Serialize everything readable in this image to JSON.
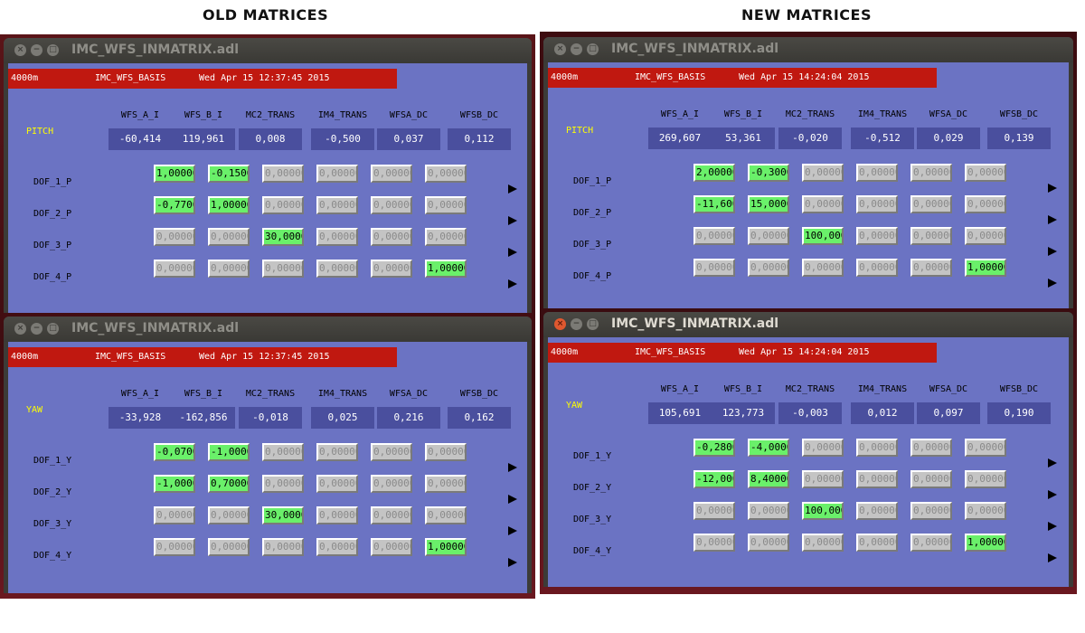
{
  "headings": {
    "old": "OLD MATRICES",
    "new": "NEW MATRICES"
  },
  "window_title": "IMC_WFS_INMATRIX.adl",
  "site": "4000m",
  "basis": "IMC_WFS_BASIS",
  "columns": [
    "WFS_A_I",
    "WFS_B_I",
    "MC2_TRANS",
    "IM4_TRANS",
    "WFSA_DC",
    "WFSB_DC"
  ],
  "colors": {
    "red_bar": "#c01810",
    "panel": "#6b73c3",
    "active_cell": "#6af06a",
    "label": "#ffff00"
  },
  "panels": [
    {
      "side": "old",
      "axis": "PITCH",
      "timestamp": "Wed Apr 15 12:37:45 2015",
      "readouts": [
        "-60,414",
        "119,961",
        "0,008",
        "-0,500",
        "0,037",
        "0,112"
      ],
      "rows": [
        {
          "label": "DOF_1_P",
          "values": [
            "1,00000",
            "-0,1500",
            "0,00000",
            "0,00000",
            "0,00000",
            "0,00000"
          ],
          "active": [
            true,
            true,
            false,
            false,
            false,
            false
          ]
        },
        {
          "label": "DOF_2_P",
          "values": [
            "-0,7700",
            "1,00000",
            "0,00000",
            "0,00000",
            "0,00000",
            "0,00000"
          ],
          "active": [
            true,
            true,
            false,
            false,
            false,
            false
          ]
        },
        {
          "label": "DOF_3_P",
          "values": [
            "0,00000",
            "0,00000",
            "30,0000",
            "0,00000",
            "0,00000",
            "0,00000"
          ],
          "active": [
            false,
            false,
            true,
            false,
            false,
            false
          ]
        },
        {
          "label": "DOF_4_P",
          "values": [
            "0,00000",
            "0,00000",
            "0,00000",
            "0,00000",
            "0,00000",
            "1,00000"
          ],
          "active": [
            false,
            false,
            false,
            false,
            false,
            true
          ]
        }
      ]
    },
    {
      "side": "old",
      "axis": "YAW",
      "timestamp": "Wed Apr 15 12:37:45 2015",
      "readouts": [
        "-33,928",
        "-162,856",
        "-0,018",
        "0,025",
        "0,216",
        "0,162"
      ],
      "rows": [
        {
          "label": "DOF_1_Y",
          "values": [
            "-0,0700",
            "-1,0000",
            "0,00000",
            "0,00000",
            "0,00000",
            "0,00000"
          ],
          "active": [
            true,
            true,
            false,
            false,
            false,
            false
          ]
        },
        {
          "label": "DOF_2_Y",
          "values": [
            "-1,0000",
            "0,70000",
            "0,00000",
            "0,00000",
            "0,00000",
            "0,00000"
          ],
          "active": [
            true,
            true,
            false,
            false,
            false,
            false
          ]
        },
        {
          "label": "DOF_3_Y",
          "values": [
            "0,00000",
            "0,00000",
            "30,0000",
            "0,00000",
            "0,00000",
            "0,00000"
          ],
          "active": [
            false,
            false,
            true,
            false,
            false,
            false
          ]
        },
        {
          "label": "DOF_4_Y",
          "values": [
            "0,00000",
            "0,00000",
            "0,00000",
            "0,00000",
            "0,00000",
            "1,00000"
          ],
          "active": [
            false,
            false,
            false,
            false,
            false,
            true
          ]
        }
      ]
    },
    {
      "side": "new",
      "axis": "PITCH",
      "timestamp": "Wed Apr 15 14:24:04 2015",
      "readouts": [
        "269,607",
        "53,361",
        "-0,020",
        "-0,512",
        "0,029",
        "0,139"
      ],
      "rows": [
        {
          "label": "DOF_1_P",
          "values": [
            "2,00000",
            "-0,3000",
            "0,00000",
            "0,00000",
            "0,00000",
            "0,00000"
          ],
          "active": [
            true,
            true,
            false,
            false,
            false,
            false
          ]
        },
        {
          "label": "DOF_2_P",
          "values": [
            "-11,600",
            "15,0000",
            "0,00000",
            "0,00000",
            "0,00000",
            "0,00000"
          ],
          "active": [
            true,
            true,
            false,
            false,
            false,
            false
          ]
        },
        {
          "label": "DOF_3_P",
          "values": [
            "0,00000",
            "0,00000",
            "100,000",
            "0,00000",
            "0,00000",
            "0,00000"
          ],
          "active": [
            false,
            false,
            true,
            false,
            false,
            false
          ]
        },
        {
          "label": "DOF_4_P",
          "values": [
            "0,00000",
            "0,00000",
            "0,00000",
            "0,00000",
            "0,00000",
            "1,00000"
          ],
          "active": [
            false,
            false,
            false,
            false,
            false,
            true
          ]
        }
      ]
    },
    {
      "side": "new",
      "axis": "YAW",
      "timestamp": "Wed Apr 15 14:24:04 2015",
      "readouts": [
        "105,691",
        "123,773",
        "-0,003",
        "0,012",
        "0,097",
        "0,190"
      ],
      "rows": [
        {
          "label": "DOF_1_Y",
          "values": [
            "-0,2800",
            "-4,0000",
            "0,00000",
            "0,00000",
            "0,00000",
            "0,00000"
          ],
          "active": [
            true,
            true,
            false,
            false,
            false,
            false
          ]
        },
        {
          "label": "DOF_2_Y",
          "values": [
            "-12,000",
            "8,40000",
            "0,00000",
            "0,00000",
            "0,00000",
            "0,00000"
          ],
          "active": [
            true,
            true,
            false,
            false,
            false,
            false
          ]
        },
        {
          "label": "DOF_3_Y",
          "values": [
            "0,00000",
            "0,00000",
            "100,000",
            "0,00000",
            "0,00000",
            "0,00000"
          ],
          "active": [
            false,
            false,
            true,
            false,
            false,
            false
          ]
        },
        {
          "label": "DOF_4_Y",
          "values": [
            "0,00000",
            "0,00000",
            "0,00000",
            "0,00000",
            "0,00000",
            "1,00000"
          ],
          "active": [
            false,
            false,
            false,
            false,
            false,
            true
          ]
        }
      ]
    }
  ]
}
